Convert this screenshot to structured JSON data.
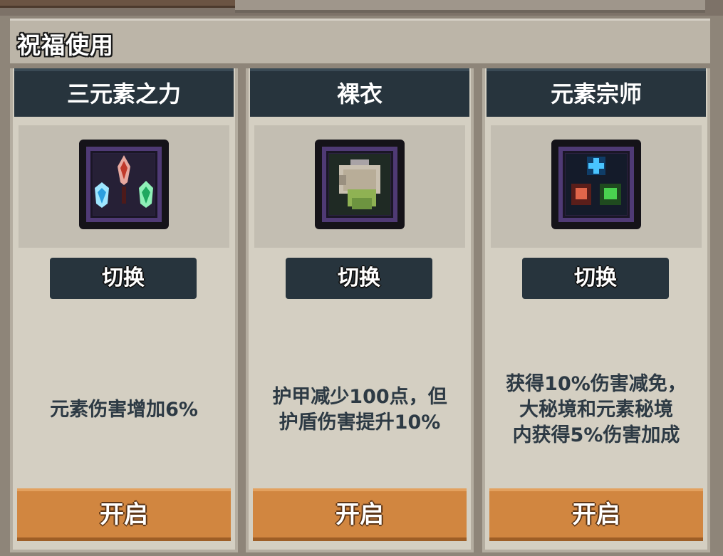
{
  "panel": {
    "title": "祝福使用"
  },
  "cards": [
    {
      "name": "三元素之力",
      "icon": "tri-element-crystals-icon",
      "switch_label": "切换",
      "description": "元素伤害增加6%",
      "open_label": "开启"
    },
    {
      "name": "裸衣",
      "icon": "naked-shirt-icon",
      "switch_label": "切换",
      "description": "护甲减少100点，但\n护盾伤害提升10%",
      "open_label": "开启"
    },
    {
      "name": "元素宗师",
      "icon": "element-master-icon",
      "switch_label": "切换",
      "description": "获得10%伤害减免，\n大秘境和元素秘境\n内获得5%伤害加成",
      "open_label": "开启"
    }
  ],
  "colors": {
    "card_header": "#27343d",
    "open_button": "#d18640",
    "card_bg": "#d4cfc2",
    "description_text": "#2d3a44"
  }
}
